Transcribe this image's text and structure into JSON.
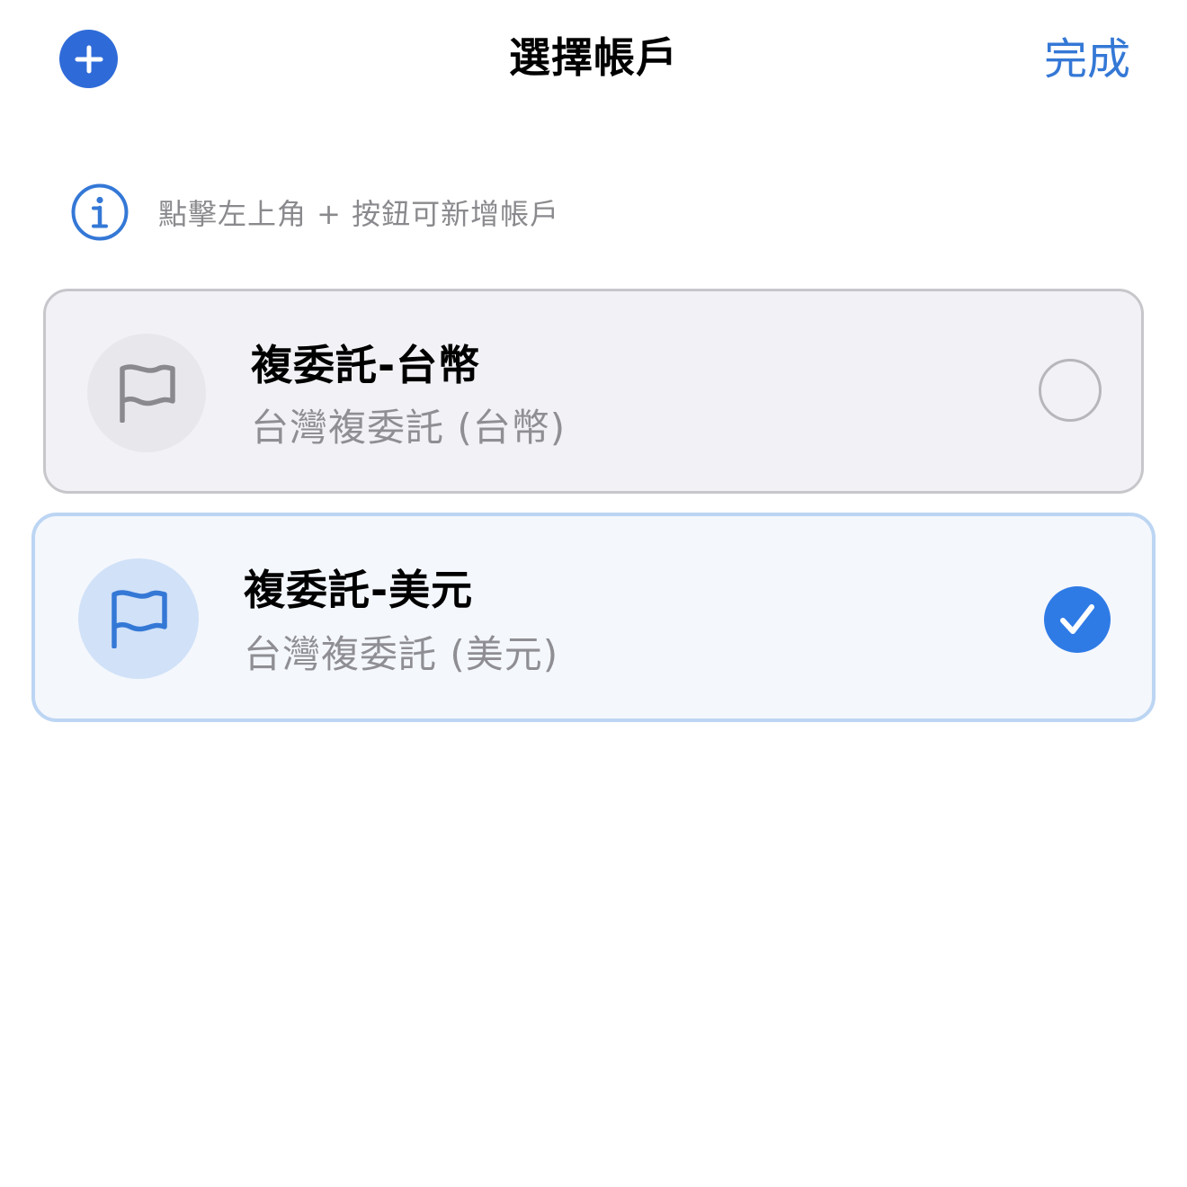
{
  "header": {
    "title": "選擇帳戶",
    "done_label": "完成",
    "add_icon": "plus-icon"
  },
  "hint": {
    "icon": "info-icon",
    "text": "點擊左上角 + 按鈕可新增帳戶"
  },
  "accounts": [
    {
      "name": "複委託-台幣",
      "description": "台灣複委託 (台幣)",
      "icon": "flag-icon",
      "selected": false
    },
    {
      "name": "複委託-美元",
      "description": "台灣複委託 (美元)",
      "icon": "flag-icon",
      "selected": true
    }
  ],
  "colors": {
    "accent": "#3478d6",
    "add_button": "#2f6bd8",
    "check_fill": "#2f7be6",
    "selected_border": "#bcd5f3",
    "unselected_bg": "#f2f2f6",
    "secondary_text": "#8e8e93"
  }
}
